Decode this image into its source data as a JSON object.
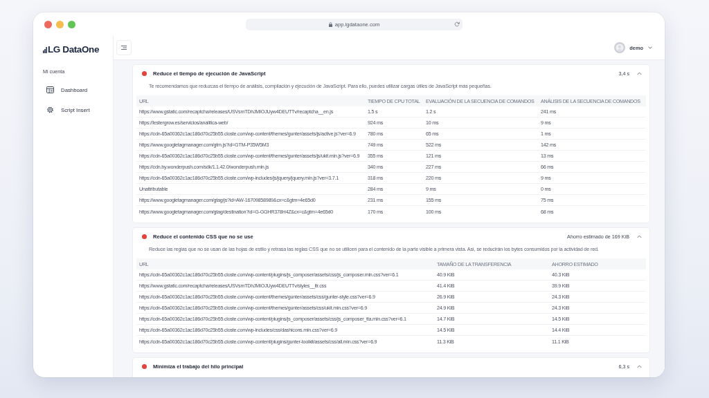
{
  "browser": {
    "address": "app.lgdataone.com"
  },
  "sidebar": {
    "brand": "LG DataOne",
    "section_label": "Mi cuenta",
    "items": [
      "Dashboard",
      "Script Insert"
    ]
  },
  "header": {
    "user": "demo"
  },
  "audits": [
    {
      "title": "Reduce el tiempo de ejecución de JavaScript",
      "value": "3,4 s",
      "expanded": true,
      "description": "Te recomendamos que reduzcas el tiempo de análisis, compilación y ejecución de JavaScript. Para ello, puedes utilizar cargas útiles de JavaScript más pequeñas.",
      "table": {
        "columns": [
          "URL",
          "TIEMPO DE CPU TOTAL",
          "EVALUACIÓN DE LA SECUENCIA DE COMANDOS",
          "ANÁLISIS DE LA SECUENCIA DE COMANDOS"
        ],
        "rows": [
          [
            "https://www.gstatic.com/recaptcha/releases/USVsmTDhJMIOJUyw4DEUTTv/recaptcha__en.js",
            "1.5 s",
            "1.2 s",
            "241 ms"
          ],
          [
            "https://lestergrow.es/servicios/analitica-web/",
            "924 ms",
            "10 ms",
            "9 ms"
          ],
          [
            "https://cdn-65a00362c1ac186d70c25b55.closte.com/wp-content/themes/gunter/assets/js/active.js?ver=6.9",
            "780 ms",
            "65 ms",
            "1 ms"
          ],
          [
            "https://www.googletagmanager.com/gtm.js?id=GTM-P35W5M3",
            "749 ms",
            "522 ms",
            "142 ms"
          ],
          [
            "https://cdn-65a00362c1ac186d70c25b55.closte.com/wp-content/themes/gunter/assets/js/ukit.min.js?ver=6.9",
            "355 ms",
            "121 ms",
            "13 ms"
          ],
          [
            "https://cdn.by.wonderpush.com/sdk/1.1.42.0/wonderpush.min.js",
            "340 ms",
            "227 ms",
            "66 ms"
          ],
          [
            "https://cdn-65a00362c1ac186d70c25b55.closte.com/wp-includes/js/jquery/jquery.min.js?ver=3.7.1",
            "318 ms",
            "220 ms",
            "9 ms"
          ],
          [
            "Unattributable",
            "284 ms",
            "9 ms",
            "0 ms"
          ],
          [
            "https://www.googletagmanager.com/gtag/js?id=AW-16709858989&cx=c&gtm=4e65d0",
            "231 ms",
            "155 ms",
            "75 ms"
          ],
          [
            "https://www.googletagmanager.com/gtag/destination?id=G-GGHR378H4Z&cx=c&gtm=4e65d0",
            "170 ms",
            "100 ms",
            "68 ms"
          ]
        ]
      }
    },
    {
      "title": "Reduce el contenido CSS que no se use",
      "value": "Ahorro estimado de 169 KiB",
      "expanded": true,
      "description": "Reduce las reglas que no se usan de las hojas de estilo y retrasa las reglas CSS que no se utilicen para el contenido de la parte visible a primera vista. Así, se reducirán los bytes consumidos por la actividad de red.",
      "table": {
        "columns": [
          "URL",
          "TAMAÑO DE LA TRANSFERENCIA",
          "AHORRO ESTIMADO"
        ],
        "rows": [
          [
            "https://cdn-65a00362c1ac186d70c25b55.closte.com/wp-content/plugins/js_composer/assets/css/js_composer.min.css?ver=6.1",
            "40.9 KiB",
            "40.3 KiB"
          ],
          [
            "https://www.gstatic.com/recaptcha/releases/USVsmTDhJMIOJUyw4DEUTTv/styles__ltr.css",
            "41.4 KiB",
            "39.9 KiB"
          ],
          [
            "https://cdn-65a00362c1ac186d70c25b55.closte.com/wp-content/themes/gunter/assets/css/gunter-style.css?ver=6.9",
            "26.9 KiB",
            "24.3 KiB"
          ],
          [
            "https://cdn-65a00362c1ac186d70c25b55.closte.com/wp-content/themes/gunter/assets/css/ukit.min.css?ver=6.9",
            "24.9 KiB",
            "24.3 KiB"
          ],
          [
            "https://cdn-65a00362c1ac186d70c25b55.closte.com/wp-content/plugins/js_composer/assets/css/js_composer_tta.min.css?ver=6.1",
            "14.7 KiB",
            "14.5 KiB"
          ],
          [
            "https://cdn-65a00362c1ac186d70c25b55.closte.com/wp-includes/css/dashicons.min.css?ver=6.9",
            "14.5 KiB",
            "14.4 KiB"
          ],
          [
            "https://cdn-65a00362c1ac186d70c25b55.closte.com/wp-content/plugins/gunter-toolkit/assets/css/all.min.css?ver=6.9",
            "11.3 KiB",
            "11.1 KiB"
          ]
        ]
      }
    },
    {
      "title": "Minimiza el trabajo del hilo principal",
      "value": "6,3 s",
      "expanded": true
    }
  ]
}
